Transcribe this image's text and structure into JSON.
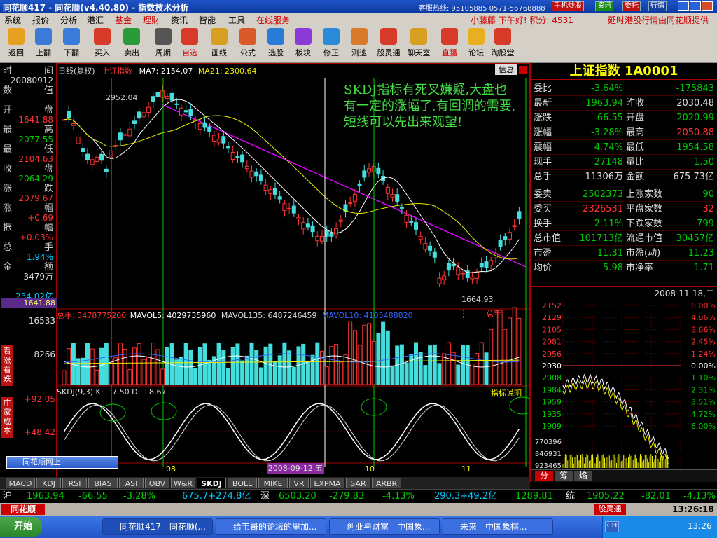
{
  "window": {
    "title": "同花顺417 - 同花顺(v4.40.80) - 指数技术分析",
    "hotline": "客服热线: 95105885  0571-56768888",
    "btn_mobile": "手机炒股",
    "btn_news": "资讯",
    "btn_trust": "委托",
    "btn_quote": "行情"
  },
  "menu": [
    "系统",
    "报价",
    "分析",
    "港汇",
    "基金",
    "理财",
    "资讯",
    "智能",
    "工具",
    "在线服务"
  ],
  "user_greeting": "小藤藤 下午好!  积分: 4531",
  "hk_notice": "延时港股行情由同花顺提供",
  "toolbar": [
    "返回",
    "上翻",
    "下翻",
    "买入",
    "卖出",
    "周期",
    "自选",
    "画线",
    "公式",
    "选股",
    "板块",
    "修正",
    "测速",
    "股灵通",
    "聊天室",
    "直播",
    "论坛",
    "淘股堂"
  ],
  "left_labels": [
    [
      "时",
      "间",
      "20080912"
    ],
    [
      "数",
      "值",
      ""
    ],
    [
      "开",
      "盘",
      "1641.88"
    ],
    [
      "最",
      "高",
      "2077.55"
    ],
    [
      "最",
      "低",
      "2104.63"
    ],
    [
      "收",
      "盘",
      "2064.29"
    ],
    [
      "涨",
      "跌",
      "2079.67"
    ],
    [
      "涨",
      "幅",
      "+0.69"
    ],
    [
      "振",
      "幅",
      "+0.03%"
    ],
    [
      "总",
      "手",
      "1.94%"
    ],
    [
      "金",
      "额",
      "3479万"
    ],
    [
      "",
      "",
      "234.02亿"
    ]
  ],
  "main": {
    "header": "日线(复权)",
    "index_name": "上证指数",
    "ma7": "MA7: 2154.07",
    "ma21": "MA21: 2300.64",
    "info": "信息",
    "high_label": "2952.04",
    "low_label": "1664.93",
    "annotation": "SKDJ指标有死叉嫌疑,大盘也有一定的涨幅了,有回调的需要,短线可以先出来观望!",
    "price_bottom": "1641.88",
    "vol_header": "总手: 3478775200",
    "mavol5": "MAVOL5: 4029735960",
    "mavol135": "MAVOL135: 6487246459",
    "mavol10": "MAVOL10: 4105488820",
    "vol_sel": "总手",
    "vol_top": "16533",
    "vol_mid": "8266",
    "skdj_header": "SKDJ(9,3)  K: +7.50  D: +8.67",
    "skdj_help": "指标说明",
    "skdj_top": "+92.05",
    "skdj_mid": "+48.42",
    "date_sel": "2008-09-12,五",
    "months": [
      "08",
      "10",
      "11"
    ],
    "side_tab1": "看涨看跌",
    "side_tab2": "庄家成本",
    "float_title": "同花顺网上"
  },
  "tabs": [
    "MACD",
    "KDJ",
    "RSI",
    "BIAS",
    "ASI",
    "OBV",
    "W&R",
    "SKDJ",
    "BOLL",
    "MIKE",
    "VR",
    "EXPMA",
    "SAR",
    "ARBR"
  ],
  "right": {
    "title": "上证指数 1A0001",
    "rows": [
      [
        "委比",
        "-3.64%",
        "",
        "-175843"
      ],
      [
        "最新",
        "1963.94",
        "昨收",
        "2030.48"
      ],
      [
        "涨跌",
        "-66.55",
        "开盘",
        "2020.99"
      ],
      [
        "涨幅",
        "-3.28%",
        "最高",
        "2050.88"
      ],
      [
        "震幅",
        "4.74%",
        "最低",
        "1954.58"
      ],
      [
        "现手",
        "27148",
        "量比",
        "1.50"
      ],
      [
        "总手",
        "11306万",
        "金额",
        "675.73亿"
      ],
      [
        "委卖",
        "2502373",
        "上涨家数",
        "90"
      ],
      [
        "委买",
        "2326531",
        "平盘家数",
        "32"
      ],
      [
        "换手",
        "2.11%",
        "下跌家数",
        "799"
      ],
      [
        "总市值",
        "101713亿",
        "流通市值",
        "30457亿"
      ],
      [
        "市盈",
        "11.31",
        "市盈(动)",
        "11.23"
      ],
      [
        "均价",
        "5.98",
        "市净率",
        "1.71"
      ]
    ],
    "date": "2008-11-18,二",
    "left_axis": [
      "2152",
      "2129",
      "2105",
      "2081",
      "2056",
      "2030",
      "2008",
      "1984",
      "1959",
      "1935",
      "1909",
      "770396",
      "846931",
      "923465"
    ],
    "right_axis": [
      "6.00%",
      "4.86%",
      "3.66%",
      "2.45%",
      "1.24%",
      "0.00%",
      "1.10%",
      "2.31%",
      "3.51%",
      "4.72%",
      "6.00%"
    ],
    "subtabs": [
      "分",
      "筹",
      "焰"
    ]
  },
  "status": {
    "sh": "沪",
    "sh_price": "1963.94",
    "sh_chg": "-66.55",
    "sh_pct": "-3.28%",
    "sh_amt": "675.7+274.8亿",
    "sz": "深",
    "sz_price": "6503.20",
    "sz_chg": "-279.83",
    "sz_pct": "-4.13%",
    "sz_amt": "290.3+49.2亿",
    "third": "1289.81",
    "uni": "统",
    "uni_price": "1905.22",
    "uni_chg": "-82.01",
    "uni_pct": "-4.13%"
  },
  "bottombar": {
    "logo": "同花顺",
    "service": "股灵通",
    "time": "13:26:18"
  },
  "taskbar": {
    "start": "开始",
    "tasks": [
      "同花顺417 - 同花顺(...",
      "给韦哥的论坛的里加...",
      "创业与财富 - 中国象...",
      "未来 - 中国象棋..."
    ],
    "clock": "13:26",
    "ime": "CH"
  }
}
